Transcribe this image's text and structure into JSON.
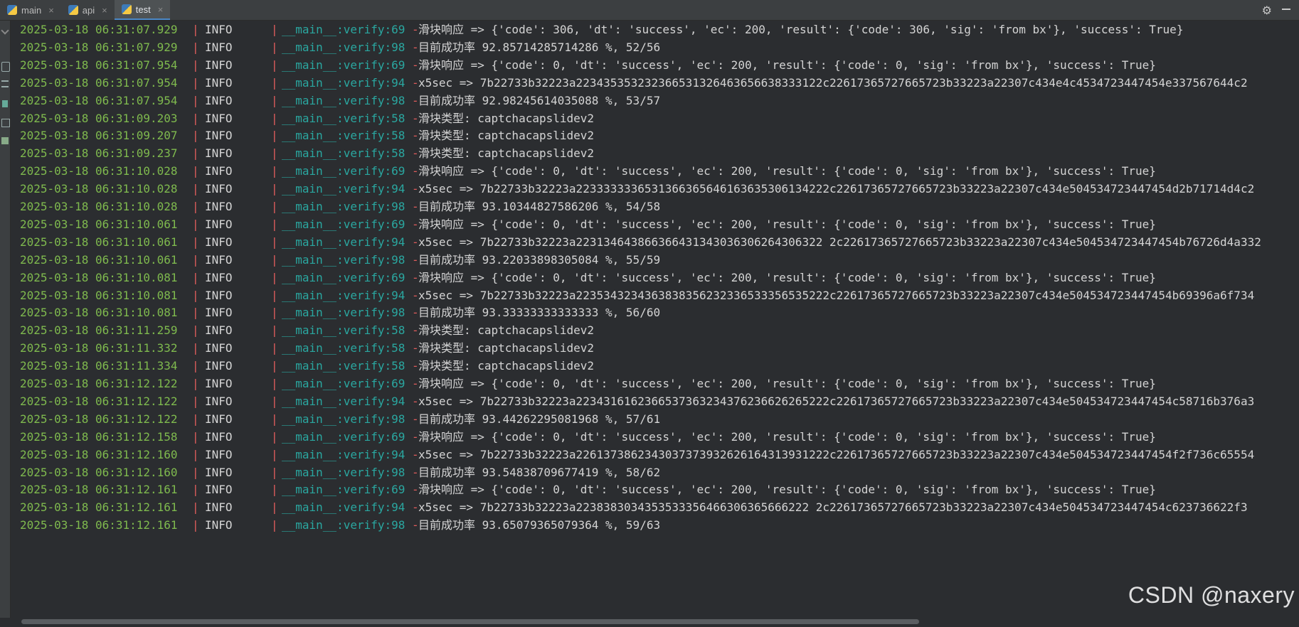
{
  "tabs": [
    {
      "label": "main",
      "active": false
    },
    {
      "label": "api",
      "active": false
    },
    {
      "label": "test",
      "active": true
    }
  ],
  "watermark": "CSDN @naxery",
  "colors": {
    "timestamp": "#7fba4e",
    "separator": "#e05c5c",
    "module": "#2aa7a0",
    "text": "#d4d4d4"
  },
  "log": [
    {
      "ts": "2025-03-18 06:31:07.929",
      "level": "INFO",
      "module": "__main__:verify:69",
      "msg": "滑块响应 => {'code': 306, 'dt': 'success', 'ec': 200, 'result': {'code': 306, 'sig': 'from bx'}, 'success': True}"
    },
    {
      "ts": "2025-03-18 06:31:07.929",
      "level": "INFO",
      "module": "__main__:verify:98",
      "msg": "目前成功率 92.85714285714286 %, 52/56"
    },
    {
      "ts": "2025-03-18 06:31:07.954",
      "level": "INFO",
      "module": "__main__:verify:69",
      "msg": "滑块响应 => {'code': 0, 'dt': 'success', 'ec': 200, 'result': {'code': 0, 'sig': 'from bx'}, 'success': True}"
    },
    {
      "ts": "2025-03-18 06:31:07.954",
      "level": "INFO",
      "module": "__main__:verify:94",
      "msg": "x5sec => 7b22733b32223a223435353232366531326463656638333122c22617365727665723b33223a22307c434e4c4534723447454e337567644c2"
    },
    {
      "ts": "2025-03-18 06:31:07.954",
      "level": "INFO",
      "module": "__main__:verify:98",
      "msg": "目前成功率 92.98245614035088 %, 53/57"
    },
    {
      "ts": "2025-03-18 06:31:09.203",
      "level": "INFO",
      "module": "__main__:verify:58",
      "msg": "滑块类型: captchacapslidev2"
    },
    {
      "ts": "2025-03-18 06:31:09.207",
      "level": "INFO",
      "module": "__main__:verify:58",
      "msg": "滑块类型: captchacapslidev2"
    },
    {
      "ts": "2025-03-18 06:31:09.237",
      "level": "INFO",
      "module": "__main__:verify:58",
      "msg": "滑块类型: captchacapslidev2"
    },
    {
      "ts": "2025-03-18 06:31:10.028",
      "level": "INFO",
      "module": "__main__:verify:69",
      "msg": "滑块响应 => {'code': 0, 'dt': 'success', 'ec': 200, 'result': {'code': 0, 'sig': 'from bx'}, 'success': True}"
    },
    {
      "ts": "2025-03-18 06:31:10.028",
      "level": "INFO",
      "module": "__main__:verify:94",
      "msg": "x5sec => 7b22733b32223a2233333336531366365646163635306134222c22617365727665723b33223a22307c434e504534723447454d2b71714d4c2"
    },
    {
      "ts": "2025-03-18 06:31:10.028",
      "level": "INFO",
      "module": "__main__:verify:98",
      "msg": "目前成功率 93.1034482758620​6 %, 54/58"
    },
    {
      "ts": "2025-03-18 06:31:10.061",
      "level": "INFO",
      "module": "__main__:verify:69",
      "msg": "滑块响应 => {'code': 0, 'dt': 'success', 'ec': 200, 'result': {'code': 0, 'sig': 'from bx'}, 'success': True}"
    },
    {
      "ts": "2025-03-18 06:31:10.061",
      "level": "INFO",
      "module": "__main__:verify:94",
      "msg": "x5sec => 7b22733b32223a223134643866366431343036306264306322 2c22617365727665723b33223a22307c434e504534723447454b76726d4a332"
    },
    {
      "ts": "2025-03-18 06:31:10.061",
      "level": "INFO",
      "module": "__main__:verify:98",
      "msg": "目前成功率 93.22033898305084 %, 55/59"
    },
    {
      "ts": "2025-03-18 06:31:10.081",
      "level": "INFO",
      "module": "__main__:verify:69",
      "msg": "滑块响应 => {'code': 0, 'dt': 'success', 'ec': 200, 'result': {'code': 0, 'sig': 'from bx'}, 'success': True}"
    },
    {
      "ts": "2025-03-18 06:31:10.081",
      "level": "INFO",
      "module": "__main__:verify:94",
      "msg": "x5sec => 7b22733b32223a2235343234363838356232336533356535222c22617365727665723b33223a22307c434e504534723447454b69396a6f734"
    },
    {
      "ts": "2025-03-18 06:31:10.081",
      "level": "INFO",
      "module": "__main__:verify:98",
      "msg": "目前成功率 93.33333333333333 %, 56/60"
    },
    {
      "ts": "2025-03-18 06:31:11.259",
      "level": "INFO",
      "module": "__main__:verify:58",
      "msg": "滑块类型: captchacapslidev2"
    },
    {
      "ts": "2025-03-18 06:31:11.332",
      "level": "INFO",
      "module": "__main__:verify:58",
      "msg": "滑块类型: captchacapslidev2"
    },
    {
      "ts": "2025-03-18 06:31:11.334",
      "level": "INFO",
      "module": "__main__:verify:58",
      "msg": "滑块类型: captchacapslidev2"
    },
    {
      "ts": "2025-03-18 06:31:12.122",
      "level": "INFO",
      "module": "__main__:verify:69",
      "msg": "滑块响应 => {'code': 0, 'dt': 'success', 'ec': 200, 'result': {'code': 0, 'sig': 'from bx'}, 'success': True}"
    },
    {
      "ts": "2025-03-18 06:31:12.122",
      "level": "INFO",
      "module": "__main__:verify:94",
      "msg": "x5sec => 7b22733b32223a2234316162366537363234376236626265222c22617365727665723b33223a22307c434e504534723447454c58716b376a3"
    },
    {
      "ts": "2025-03-18 06:31:12.122",
      "level": "INFO",
      "module": "__main__:verify:98",
      "msg": "目前成功率 93.44262295081968 %, 57/61"
    },
    {
      "ts": "2025-03-18 06:31:12.158",
      "level": "INFO",
      "module": "__main__:verify:69",
      "msg": "滑块响应 => {'code': 0, 'dt': 'success', 'ec': 200, 'result': {'code': 0, 'sig': 'from bx'}, 'success': True}"
    },
    {
      "ts": "2025-03-18 06:31:12.160",
      "level": "INFO",
      "module": "__main__:verify:94",
      "msg": "x5sec => 7b22733b32223a2261373862343037373932626164313931222c22617365727665723b33223a22307c434e504534723447454f2f736c65554"
    },
    {
      "ts": "2025-03-18 06:31:12.160",
      "level": "INFO",
      "module": "__main__:verify:98",
      "msg": "目前成功率 93.54838709677419 %, 58/62"
    },
    {
      "ts": "2025-03-18 06:31:12.161",
      "level": "INFO",
      "module": "__main__:verify:69",
      "msg": "滑块响应 => {'code': 0, 'dt': 'success', 'ec': 200, 'result': {'code': 0, 'sig': 'from bx'}, 'success': True}"
    },
    {
      "ts": "2025-03-18 06:31:12.161",
      "level": "INFO",
      "module": "__main__:verify:94",
      "msg": "x5sec => 7b22733b32223a2238383034353533356466306365666222 2c22617365727665723b33223a22307c434e504534723447454c623736622f3"
    },
    {
      "ts": "2025-03-18 06:31:12.161",
      "level": "INFO",
      "module": "__main__:verify:98",
      "msg": "目前成功率 93.65079365079364 %, 59/63"
    }
  ]
}
